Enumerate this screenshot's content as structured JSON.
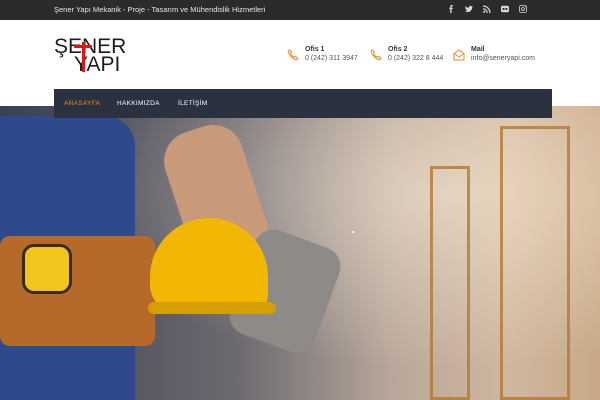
{
  "topbar": {
    "tagline": "Şener Yapı Mekanik - Proje - Tasarım ve Mühendislik Hizmetleri",
    "social_icons": [
      "facebook-icon",
      "twitter-icon",
      "rss-icon",
      "flickr-icon",
      "instagram-icon"
    ]
  },
  "logo": {
    "line1": "ŞENER",
    "line2": "YAPI",
    "accent_color": "#d21c1c"
  },
  "contacts": [
    {
      "title": "Ofis 1",
      "value": "0 (242) 311 3947",
      "icon": "phone-icon"
    },
    {
      "title": "Ofis 2",
      "value": "0 (242) 322 8 444",
      "icon": "phone-icon"
    },
    {
      "title": "Mail",
      "value": "info@seneryapi.com",
      "icon": "mail-icon"
    }
  ],
  "nav": {
    "items": [
      {
        "label": "ANASAYFA",
        "active": true
      },
      {
        "label": "HAKKIMIZDA",
        "active": false
      },
      {
        "label": "İLETİŞİM",
        "active": false
      }
    ],
    "active_color": "#e58b2a",
    "bg_color": "#2c3140"
  },
  "colors": {
    "topbar_bg": "#2b2b2b",
    "icon_accent": "#e58b2a"
  }
}
